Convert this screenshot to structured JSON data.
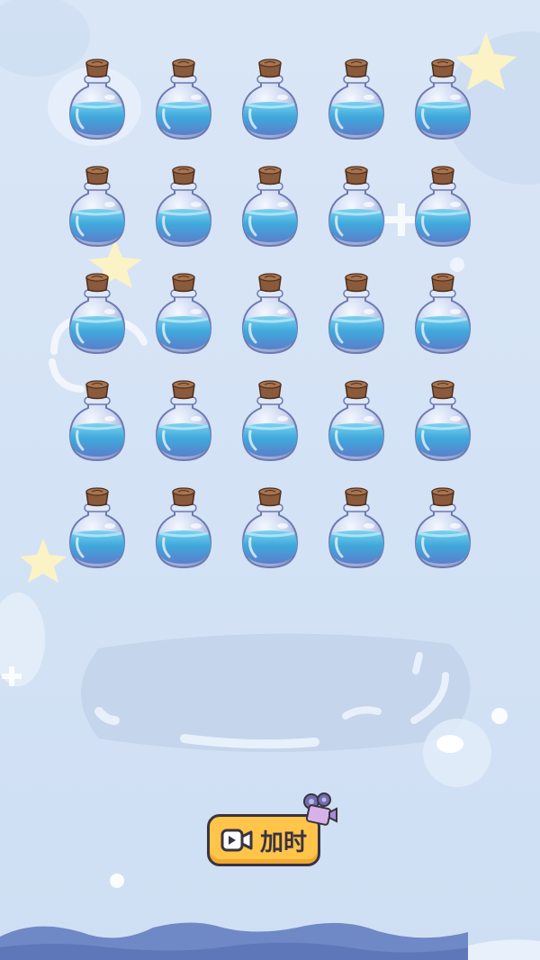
{
  "game": {
    "bottle_icon": "potion-bottle-icon",
    "rows": 5,
    "cols": 5,
    "bottles": [
      {
        "id": "r1c1"
      },
      {
        "id": "r1c2"
      },
      {
        "id": "r1c3"
      },
      {
        "id": "r1c4"
      },
      {
        "id": "r1c5"
      },
      {
        "id": "r2c1"
      },
      {
        "id": "r2c2"
      },
      {
        "id": "r2c3"
      },
      {
        "id": "r2c4"
      },
      {
        "id": "r2c5"
      },
      {
        "id": "r3c1"
      },
      {
        "id": "r3c2"
      },
      {
        "id": "r3c3"
      },
      {
        "id": "r3c4"
      },
      {
        "id": "r3c5"
      },
      {
        "id": "r4c1"
      },
      {
        "id": "r4c2"
      },
      {
        "id": "r4c3"
      },
      {
        "id": "r4c4"
      },
      {
        "id": "r4c5"
      },
      {
        "id": "r5c1"
      },
      {
        "id": "r5c2"
      },
      {
        "id": "r5c3"
      },
      {
        "id": "r5c4"
      },
      {
        "id": "r5c5"
      }
    ]
  },
  "add_time_button": {
    "label": "加时",
    "icon": "video-camera-icon",
    "badge_icon": "film-camera-icon"
  },
  "colors": {
    "background": "#d5e3f5",
    "liquid": "#4fb3de",
    "cork": "#8a5a3c",
    "button": "#ffc44a",
    "button_outline": "#3a3340",
    "star": "#fbf3c6"
  }
}
